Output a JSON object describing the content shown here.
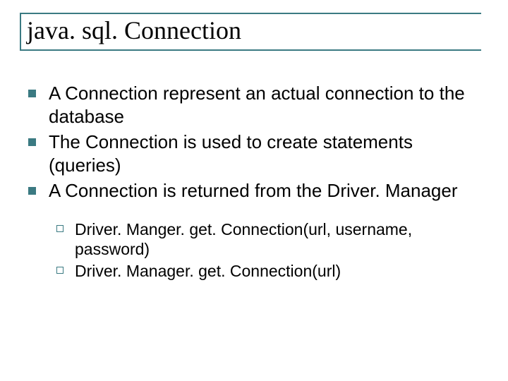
{
  "title": "java. sql. Connection",
  "bullets": [
    "A Connection represent an actual connection to the database",
    "The Connection is used to create statements (queries)",
    "A Connection is returned from the Driver. Manager"
  ],
  "subbullets": [
    "Driver. Manger. get. Connection(url, username, password)",
    "Driver. Manager. get. Connection(url)"
  ]
}
